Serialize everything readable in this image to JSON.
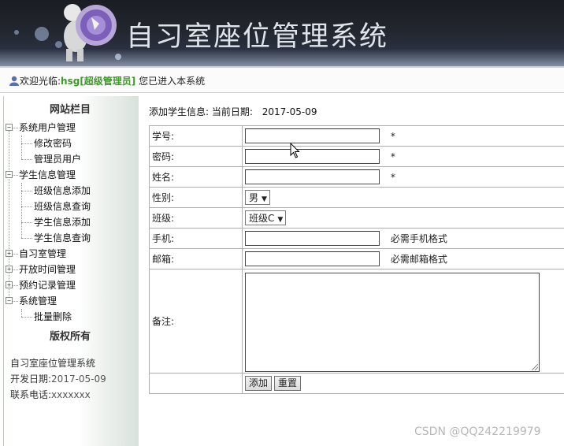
{
  "banner": {
    "title": "自习室座位管理系统"
  },
  "welcome": {
    "prefix": "欢迎光临:",
    "user": "hsg[超级管理员]",
    "suffix": "您已进入本系统"
  },
  "sidebar": {
    "heading": "网站栏目",
    "groups": [
      {
        "label": "系统用户管理",
        "expanded": true,
        "children": [
          "修改密码",
          "管理员用户"
        ]
      },
      {
        "label": "学生信息管理",
        "expanded": true,
        "children": [
          "班级信息添加",
          "班级信息查询",
          "学生信息添加",
          "学生信息查询"
        ]
      },
      {
        "label": "自习室管理",
        "expanded": false,
        "children": []
      },
      {
        "label": "开放时间管理",
        "expanded": false,
        "children": []
      },
      {
        "label": "预约记录管理",
        "expanded": false,
        "children": []
      },
      {
        "label": "系统管理",
        "expanded": true,
        "children": [
          "批量删除"
        ]
      }
    ],
    "copyright_title": "版权所有",
    "system_name": "自习室座位管理系统",
    "dev_date_label": "开发日期:",
    "dev_date": "2017-05-09",
    "phone_label": "联系电话:",
    "phone": "xxxxxxx"
  },
  "form": {
    "heading": "添加学生信息:",
    "date_label": "当前日期:",
    "date": "2017-05-09",
    "fields": {
      "student_id": {
        "label": "学号:",
        "value": "",
        "note": "*"
      },
      "password": {
        "label": "密码:",
        "value": "",
        "note": "*"
      },
      "name": {
        "label": "姓名:",
        "value": "",
        "note": "*"
      },
      "gender": {
        "label": "性别:",
        "selected": "男"
      },
      "class": {
        "label": "班级:",
        "selected": "班级C"
      },
      "phone": {
        "label": "手机:",
        "value": "",
        "note": "必需手机格式"
      },
      "email": {
        "label": "邮箱:",
        "value": "",
        "note": "必需邮箱格式"
      },
      "remark": {
        "label": "备注:",
        "value": ""
      }
    },
    "add_button": "添加",
    "reset_button": "重置"
  },
  "watermark": "CSDN @QQ242219979"
}
